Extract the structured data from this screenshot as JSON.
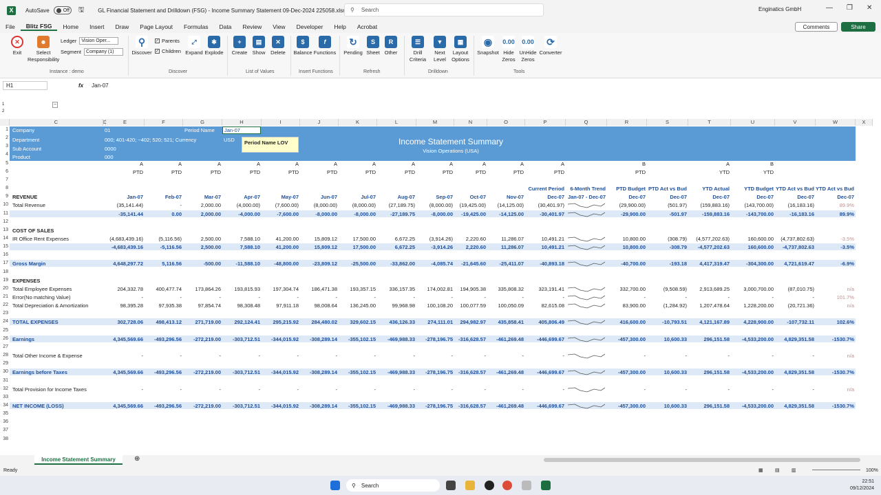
{
  "app": {
    "title": "GL Financial Statement and Drilldown (FSG) - Income Summary Statement 09-Dec-2024 225058.xlsm",
    "autosave_label": "AutoSave",
    "autosave_state": "Off",
    "search_placeholder": "Search",
    "account": "Enginatics GmbH"
  },
  "menu": [
    "File",
    "Blitz FSG",
    "Home",
    "Insert",
    "Draw",
    "Page Layout",
    "Formulas",
    "Data",
    "Review",
    "View",
    "Developer",
    "Help",
    "Acrobat"
  ],
  "buttons": {
    "comments": "Comments",
    "share": "Share"
  },
  "ribbon": {
    "exit": "Exit",
    "select_resp": "Select\nResponsibility",
    "instance": "Instance : demo",
    "ledger_label": "Ledger",
    "ledger_value": "Vision Oper...",
    "segment_label": "Segment",
    "segment_value": "Company (1)",
    "discover": "Discover",
    "parents": "Parents",
    "children": "Children",
    "expand": "Expand",
    "explode": "Explode",
    "grp_discover": "Discover",
    "create": "Create",
    "show": "Show",
    "delete": "Delete",
    "grp_lov": "List of Values",
    "balance": "Balance",
    "functions": "Functions",
    "grp_insert": "Insert Functions",
    "pending": "Pending",
    "sheet": "Sheet",
    "other": "Other",
    "grp_refresh": "Refresh",
    "drill": "Drill\nCriteria",
    "next": "Next\nLevel",
    "layout": "Layout\nOptions",
    "grp_drill": "Drilldown",
    "snapshot": "Snapshot",
    "hide": "Hide\nZeros",
    "unhide": "UnHide\nZeros",
    "converter": "Converter",
    "grp_tools": "Tools"
  },
  "formula": {
    "namebox": "H1",
    "fx": "fx",
    "value": "Jan-07"
  },
  "columns": [
    "C",
    "D",
    "E",
    "F",
    "G",
    "H",
    "I",
    "J",
    "K",
    "L",
    "M",
    "N",
    "O",
    "P",
    "Q",
    "R",
    "S",
    "T",
    "U",
    "V",
    "W",
    "X"
  ],
  "header_cells": {
    "company_label": "Company",
    "company_val": "01",
    "period_label": "Period Name",
    "period_val": "Jan-07",
    "dept_label": "Department",
    "dept_val": "000;  401-420;  ~402; 520; 521;  Currency",
    "usd": "USD",
    "sub_label": "Sub Account",
    "sub_val": "0000",
    "product_label": "Product",
    "product_val": "000",
    "title": "Income Statement Summary",
    "subtitle": "Vision Operations (USA)",
    "tooltip": "Period Name LOV"
  },
  "row5": [
    "A",
    "A",
    "A",
    "A",
    "A",
    "A",
    "A",
    "A",
    "A",
    "A",
    "A",
    "A",
    "",
    "B",
    "",
    "A",
    "B",
    "",
    ""
  ],
  "row6": [
    "PTD",
    "PTD",
    "PTD",
    "PTD",
    "PTD",
    "PTD",
    "PTD",
    "PTD",
    "PTD",
    "PTD",
    "PTD",
    "PTD",
    "",
    "PTD",
    "",
    "YTD",
    "YTD",
    "",
    ""
  ],
  "row8": [
    "",
    "",
    "",
    "",
    "",
    "",
    "",
    "",
    "",
    "",
    "",
    "Current Period",
    "6-Month Trend",
    "PTD Budget",
    "PTD Act vs Bud",
    "YTD Actual",
    "YTD Budget",
    "YTD Act vs Bud",
    "YTD Act vs Bud"
  ],
  "row9": [
    "Jan-07",
    "Feb-07",
    "Mar-07",
    "Apr-07",
    "May-07",
    "Jun-07",
    "Jul-07",
    "Aug-07",
    "Sep-07",
    "Oct-07",
    "Nov-07",
    "Dec-07",
    "Jan-07 - Dec-07",
    "Dec-07",
    "Dec-07",
    "Dec-07",
    "Dec-07",
    "Dec-07",
    "Dec-07"
  ],
  "rows": [
    {
      "n": "1"
    },
    {
      "n": "2"
    },
    {
      "n": "3"
    },
    {
      "n": "4"
    },
    {
      "n": "5"
    },
    {
      "n": "6"
    },
    {
      "n": "7"
    },
    {
      "n": "8"
    },
    {
      "n": "9",
      "label": "REVENUE",
      "style": "bold"
    },
    {
      "n": "10",
      "label": "Total  Revenue",
      "vals": [
        "(35,141.44)",
        "-",
        "2,000.00",
        "(4,000.00)",
        "(7,600.00)",
        "(8,000.00)",
        "(8,000.00)",
        "(27,189.75)",
        "(8,000.00)",
        "(19,425.00)",
        "(14,125.00)",
        "(30,401.97)",
        "~",
        "(29,900.00)",
        "(501.97)",
        "(159,883.16)",
        "(143,700.00)",
        "(16,183.16)",
        "89.9%"
      ],
      "pinklast": true
    },
    {
      "n": "11",
      "hl": true,
      "vals": [
        "-35,141.44",
        "0.00",
        "2,000.00",
        "-4,000.00",
        "-7,600.00",
        "-8,000.00",
        "-8,000.00",
        "-27,189.75",
        "-8,000.00",
        "-19,425.00",
        "-14,125.00",
        "-30,401.97",
        "~",
        "-29,900.00",
        "-501.97",
        "-159,883.16",
        "-143,700.00",
        "-16,183.16",
        "89.9%"
      ]
    },
    {
      "n": "12"
    },
    {
      "n": "13",
      "label": "COST OF SALES",
      "style": "bold"
    },
    {
      "n": "14",
      "label": "IR Office Rent Expenses",
      "vals": [
        "(4,683,439.16)",
        "(5,116.56)",
        "2,500.00",
        "7,588.10",
        "41,200.00",
        "15,809.12",
        "17,500.00",
        "6,672.25",
        "(3,914.26)",
        "2,220.60",
        "11,286.07",
        "10,491.21",
        "~",
        "10,800.00",
        "(308.79)",
        "(4,577,202.63)",
        "160,600.00",
        "(4,737,802.63)",
        "-3.5%"
      ],
      "pinklast": true
    },
    {
      "n": "15",
      "hl": true,
      "vals": [
        "-4,683,439.16",
        "-5,116.56",
        "2,500.00",
        "7,588.10",
        "41,200.00",
        "15,809.12",
        "17,500.00",
        "6,672.25",
        "-3,914.26",
        "2,220.60",
        "11,286.07",
        "10,491.21",
        "~",
        "10,800.00",
        "-308.79",
        "-4,577,202.63",
        "160,600.00",
        "-4,737,802.63",
        "-3.5%"
      ]
    },
    {
      "n": "16"
    },
    {
      "n": "17",
      "label": "Gross Margin",
      "hl": true,
      "vals": [
        "4,648,297.72",
        "5,116.56",
        "-500.00",
        "-11,588.10",
        "-48,800.00",
        "-23,809.12",
        "-25,500.00",
        "-33,862.00",
        "-4,085.74",
        "-21,645.60",
        "-25,411.07",
        "-40,893.18",
        "~",
        "-40,700.00",
        "-193.18",
        "4,417,319.47",
        "-304,300.00",
        "4,721,619.47",
        "-6.9%"
      ]
    },
    {
      "n": "18"
    },
    {
      "n": "19",
      "label": "EXPENSES",
      "style": "bold"
    },
    {
      "n": "20",
      "label": "Total Employee Expenses",
      "vals": [
        "204,332.78",
        "400,477.74",
        "173,864.26",
        "193,815.93",
        "197,304.74",
        "186,471.38",
        "193,357.15",
        "336,157.35",
        "174,002.81",
        "194,905.38",
        "335,808.32",
        "323,191.41",
        "~",
        "332,700.00",
        "(9,508.59)",
        "2,913,689.25",
        "3,000,700.00",
        "(87,010.75)",
        "n/a"
      ],
      "pinklast": true
    },
    {
      "n": "21",
      "label": "Error(No matching Value)",
      "vals": [
        "-",
        "-",
        "-",
        "-",
        "-",
        "-",
        "-",
        "-",
        "-",
        "-",
        "-",
        "-",
        "~",
        "-",
        "-",
        "-",
        "-",
        "-",
        "101.7%"
      ],
      "pinklast": true
    },
    {
      "n": "22",
      "label": "Total Depreciation & Amortization",
      "vals": [
        "98,395.28",
        "97,935.38",
        "97,854.74",
        "98,308.48",
        "97,911.18",
        "98,008.64",
        "136,245.00",
        "99,968.98",
        "100,108.20",
        "100,077.59",
        "100,050.09",
        "82,615.08",
        "~",
        "83,900.00",
        "(1,284.92)",
        "1,207,478.64",
        "1,228,200.00",
        "(20,721.36)",
        "n/a"
      ],
      "pinklast": true
    },
    {
      "n": "23"
    },
    {
      "n": "24",
      "label": "TOTAL EXPENSES",
      "hl": true,
      "vals": [
        "302,728.06",
        "498,413.12",
        "271,719.00",
        "292,124.41",
        "295,215.92",
        "284,480.02",
        "329,602.15",
        "436,126.33",
        "274,111.01",
        "294,982.97",
        "435,858.41",
        "405,806.49",
        "~",
        "416,600.00",
        "-10,793.51",
        "4,121,167.89",
        "4,228,900.00",
        "-107,732.11",
        "102.6%"
      ]
    },
    {
      "n": "25"
    },
    {
      "n": "26",
      "label": "Earnings",
      "hl": true,
      "vals": [
        "4,345,569.66",
        "-493,296.56",
        "-272,219.00",
        "-303,712.51",
        "-344,015.92",
        "-308,289.14",
        "-355,102.15",
        "-469,988.33",
        "-278,196.75",
        "-316,628.57",
        "-461,269.48",
        "-446,699.67",
        "~",
        "-457,300.00",
        "10,600.33",
        "296,151.58",
        "-4,533,200.00",
        "4,829,351.58",
        "-1530.7%"
      ]
    },
    {
      "n": "27"
    },
    {
      "n": "28",
      "label": "Total Other Income & Expense",
      "vals": [
        "-",
        "-",
        "-",
        "-",
        "-",
        "-",
        "-",
        "-",
        "-",
        "-",
        "-",
        "-",
        "~",
        "-",
        "-",
        "-",
        "-",
        "-",
        "n/a"
      ],
      "pinklast": true
    },
    {
      "n": "29"
    },
    {
      "n": "30",
      "label": "Earnings before Taxes",
      "hl": true,
      "vals": [
        "4,345,569.66",
        "-493,296.56",
        "-272,219.00",
        "-303,712.51",
        "-344,015.92",
        "-308,289.14",
        "-355,102.15",
        "-469,988.33",
        "-278,196.75",
        "-316,628.57",
        "-461,269.48",
        "-446,699.67",
        "~",
        "-457,300.00",
        "10,600.33",
        "296,151.58",
        "-4,533,200.00",
        "4,829,351.58",
        "-1530.7%"
      ]
    },
    {
      "n": "31"
    },
    {
      "n": "32",
      "label": "Total Provision for Income Taxes",
      "vals": [
        "-",
        "-",
        "-",
        "-",
        "-",
        "-",
        "-",
        "-",
        "-",
        "-",
        "-",
        "-",
        "~",
        "-",
        "-",
        "-",
        "-",
        "-",
        "n/a"
      ],
      "pinklast": true
    },
    {
      "n": "33"
    },
    {
      "n": "34",
      "label": "NET INCOME (LOSS)",
      "hl": true,
      "vals": [
        "4,345,569.66",
        "-493,296.56",
        "-272,219.00",
        "-303,712.51",
        "-344,015.92",
        "-308,289.14",
        "-355,102.15",
        "-469,988.33",
        "-278,196.75",
        "-316,628.57",
        "-461,269.48",
        "-446,699.67",
        "~",
        "-457,300.00",
        "10,600.33",
        "296,151.58",
        "-4,533,200.00",
        "4,829,351.58",
        "-1530.7%"
      ]
    },
    {
      "n": "35"
    },
    {
      "n": "36"
    },
    {
      "n": "37"
    },
    {
      "n": "38"
    }
  ],
  "sheet_tab": "Income Statement Summary",
  "status": {
    "ready": "Ready",
    "zoom": "100%"
  },
  "taskbar": {
    "search": "Search",
    "time": "22:51",
    "date": "09/12/2024"
  }
}
